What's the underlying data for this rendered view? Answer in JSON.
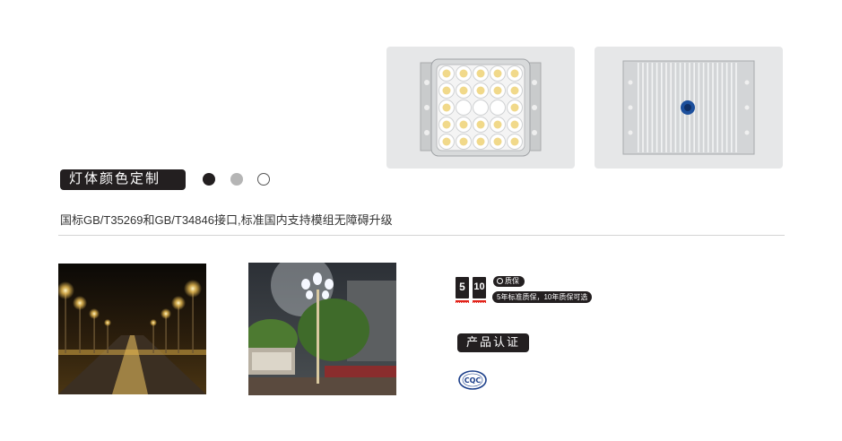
{
  "color_section": {
    "label": "灯体颜色定制",
    "swatches": [
      {
        "name": "black",
        "color": "#231f20"
      },
      {
        "name": "gray",
        "color": "#b5b5b5"
      },
      {
        "name": "white",
        "color": "#ffffff"
      }
    ]
  },
  "standard_text": "国标GB/T35269和GB/T34846接口,标准国内支持模组无障碍升级",
  "warranty": {
    "year_standard": "5",
    "year_extended": "10",
    "badge": "质保",
    "description": "5年标准质保，10年质保可选"
  },
  "certification": {
    "label": "产品认证",
    "logo_text": "CQC"
  },
  "colors": {
    "dark": "#231f20",
    "panel_bg": "#e6e7e8",
    "accent_red": "#e2231a",
    "divider": "#d4d4d4"
  }
}
